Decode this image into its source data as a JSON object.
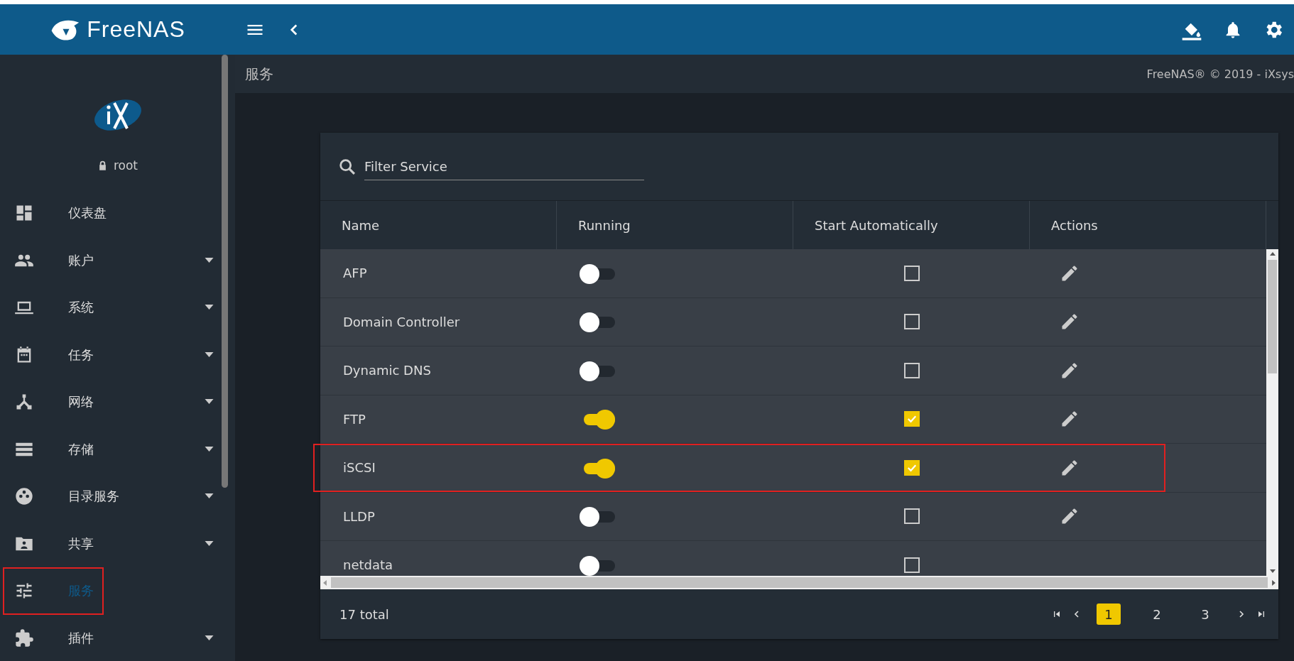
{
  "topbar": {
    "logo_text": "FreeNAS"
  },
  "sidebar": {
    "user": "root",
    "items": [
      {
        "label": "仪表盘",
        "expandable": false,
        "selected": false,
        "highlighted": false
      },
      {
        "label": "账户",
        "expandable": true,
        "selected": false,
        "highlighted": false
      },
      {
        "label": "系统",
        "expandable": true,
        "selected": false,
        "highlighted": false
      },
      {
        "label": "任务",
        "expandable": true,
        "selected": false,
        "highlighted": false
      },
      {
        "label": "网络",
        "expandable": true,
        "selected": false,
        "highlighted": false
      },
      {
        "label": "存储",
        "expandable": true,
        "selected": false,
        "highlighted": false
      },
      {
        "label": "目录服务",
        "expandable": true,
        "selected": false,
        "highlighted": false
      },
      {
        "label": "共享",
        "expandable": true,
        "selected": false,
        "highlighted": false
      },
      {
        "label": "服务",
        "expandable": false,
        "selected": true,
        "highlighted": true
      },
      {
        "label": "插件",
        "expandable": true,
        "selected": false,
        "highlighted": false
      }
    ]
  },
  "page_title": "服务",
  "copyright": "FreeNAS® © 2019 - iXsys",
  "filter": {
    "placeholder": "Filter Service"
  },
  "table": {
    "columns": [
      "Name",
      "Running",
      "Start Automatically",
      "Actions"
    ],
    "rows": [
      {
        "name": "AFP",
        "running": false,
        "start_automatically": false,
        "editable": true,
        "highlighted": false
      },
      {
        "name": "Domain Controller",
        "running": false,
        "start_automatically": false,
        "editable": true,
        "highlighted": false
      },
      {
        "name": "Dynamic DNS",
        "running": false,
        "start_automatically": false,
        "editable": true,
        "highlighted": false
      },
      {
        "name": "FTP",
        "running": true,
        "start_automatically": true,
        "editable": true,
        "highlighted": false
      },
      {
        "name": "iSCSI",
        "running": true,
        "start_automatically": true,
        "editable": true,
        "highlighted": true
      },
      {
        "name": "LLDP",
        "running": false,
        "start_automatically": false,
        "editable": true,
        "highlighted": false
      },
      {
        "name": "netdata",
        "running": false,
        "start_automatically": false,
        "editable": false,
        "highlighted": false
      }
    ]
  },
  "footer": {
    "total": "17 total",
    "pages": [
      {
        "label": "1",
        "selected": true
      },
      {
        "label": "2",
        "selected": false
      },
      {
        "label": "3",
        "selected": false
      }
    ]
  }
}
